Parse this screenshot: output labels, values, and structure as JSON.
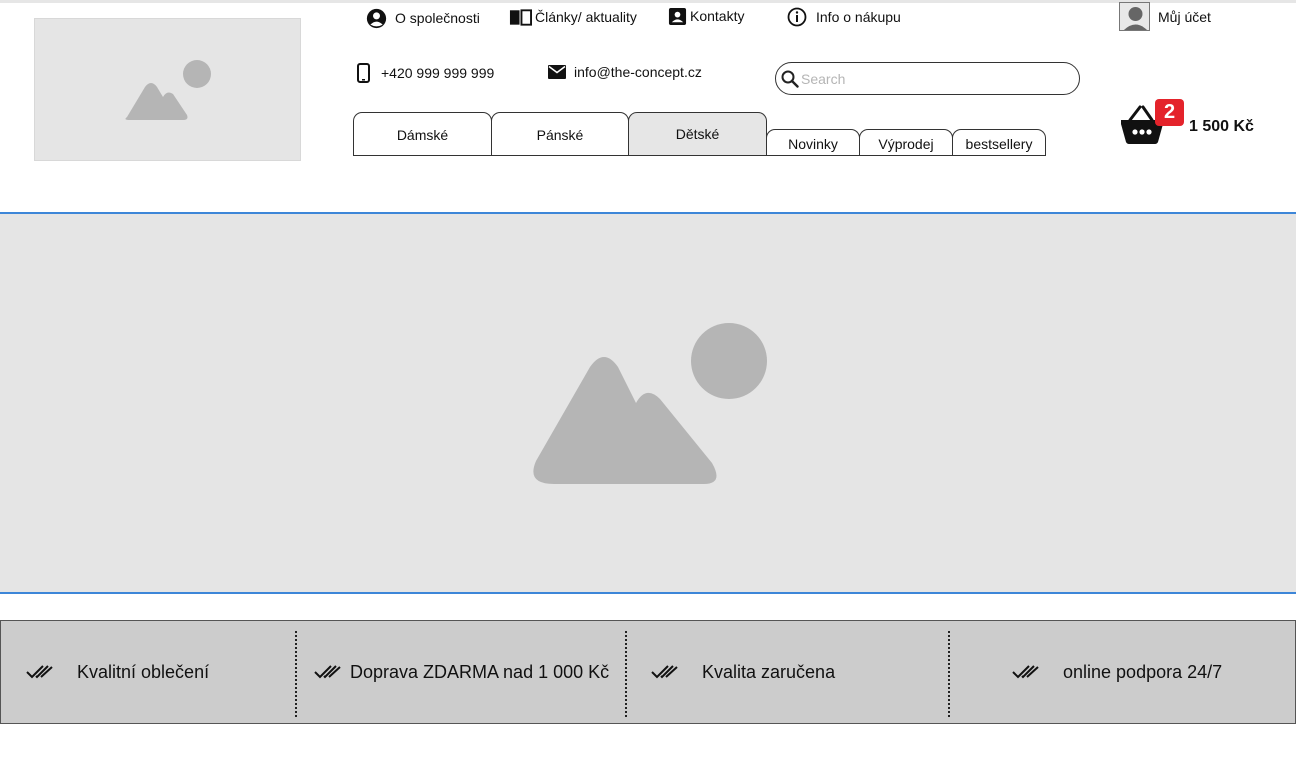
{
  "header": {
    "logo_alt": "",
    "top_links": [
      {
        "label": "O společnosti",
        "icon": "account-circle-icon"
      },
      {
        "label": "Články/ aktuality",
        "icon": "book-icon"
      },
      {
        "label": "Kontakty",
        "icon": "contact-card-icon"
      },
      {
        "label": "Info o nákupu",
        "icon": "info-icon"
      }
    ],
    "account_label": "Můj účet",
    "phone": "+420 999 999 999",
    "email": "info@the-concept.cz",
    "search_placeholder": "Search",
    "main_tabs": [
      {
        "label": "Dámské",
        "active": false
      },
      {
        "label": "Pánské",
        "active": false
      },
      {
        "label": "Dětské",
        "active": true
      }
    ],
    "secondary_tabs": [
      "Novinky",
      "Výprodej",
      "bestsellery"
    ],
    "cart": {
      "count": "2",
      "total": "1 500 Kč"
    }
  },
  "benefits": [
    "Kvalitní oblečení",
    "Doprava ZDARMA nad 1 000 Kč",
    "Kvalita zaručena",
    "online podpora 24/7"
  ],
  "colors": {
    "accent_line": "#3d86d8",
    "badge": "#e4232b",
    "placeholder_bg": "#e5e5e5",
    "benefit_bar": "#cccccc"
  }
}
